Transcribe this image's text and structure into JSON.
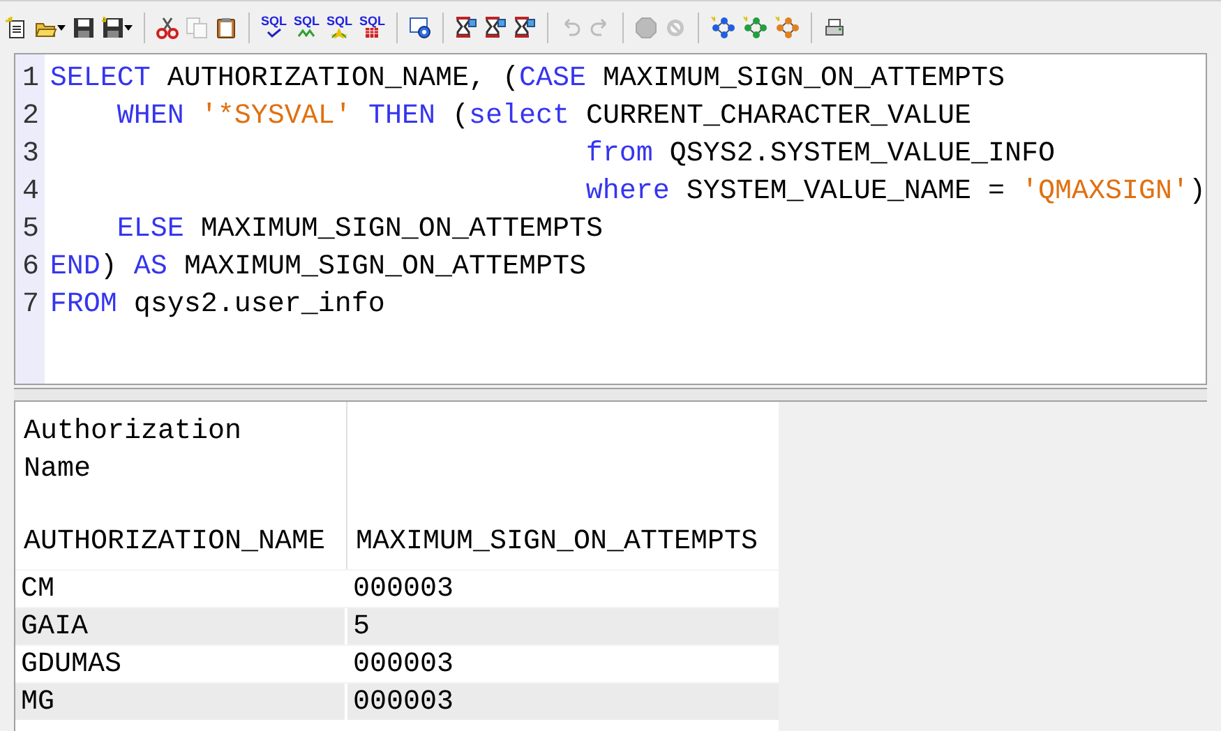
{
  "toolbar": [
    {
      "kind": "new"
    },
    {
      "kind": "open",
      "dropdown": true
    },
    {
      "kind": "save"
    },
    {
      "kind": "save-all",
      "dropdown": true
    },
    {
      "kind": "sep"
    },
    {
      "kind": "cut"
    },
    {
      "kind": "copy",
      "disabled": true
    },
    {
      "kind": "paste"
    },
    {
      "kind": "sep"
    },
    {
      "kind": "sql-check",
      "label": "SQL"
    },
    {
      "kind": "sql-run",
      "label": "SQL"
    },
    {
      "kind": "sql-run-all",
      "label": "SQL"
    },
    {
      "kind": "sql-grid",
      "label": "SQL"
    },
    {
      "kind": "sep"
    },
    {
      "kind": "settings"
    },
    {
      "kind": "sep"
    },
    {
      "kind": "hourglass"
    },
    {
      "kind": "hourglass"
    },
    {
      "kind": "hourglass"
    },
    {
      "kind": "sep"
    },
    {
      "kind": "undo",
      "disabled": true
    },
    {
      "kind": "redo",
      "disabled": true
    },
    {
      "kind": "sep"
    },
    {
      "kind": "stop",
      "disabled": true
    },
    {
      "kind": "cancel",
      "disabled": true
    },
    {
      "kind": "sep"
    },
    {
      "kind": "nodes",
      "color": "#2060e0"
    },
    {
      "kind": "nodes",
      "color": "#20a040"
    },
    {
      "kind": "nodes",
      "color": "#e08020"
    },
    {
      "kind": "sep"
    },
    {
      "kind": "print"
    }
  ],
  "editor": {
    "lines": [
      {
        "number": "1",
        "tokens": [
          {
            "kind": "kw",
            "t": "SELECT"
          },
          {
            "kind": "plain",
            "t": " AUTHORIZATION_NAME, ("
          },
          {
            "kind": "kw",
            "t": "CASE"
          },
          {
            "kind": "plain",
            "t": " MAXIMUM_SIGN_ON_ATTEMPTS"
          }
        ]
      },
      {
        "number": "2",
        "kind": "case-branch",
        "tokens": [
          {
            "kind": "kw",
            "t": "WHEN"
          },
          {
            "kind": "str",
            "t": " '*SYSVAL'"
          },
          {
            "kind": "kw",
            "t": " THEN"
          },
          {
            "kind": "plain",
            "t": " ("
          },
          {
            "kind": "kw",
            "t": "select"
          },
          {
            "kind": "plain",
            "t": " CURRENT_CHARACTER_VALUE"
          }
        ]
      },
      {
        "number": "3",
        "kind": "subquery",
        "tokens": [
          {
            "kind": "kw",
            "t": "from"
          },
          {
            "kind": "plain",
            "t": " QSYS2.SYSTEM_VALUE_INFO"
          }
        ]
      },
      {
        "number": "4",
        "kind": "subquery",
        "tokens": [
          {
            "kind": "kw",
            "t": "where"
          },
          {
            "kind": "plain",
            "t": " SYSTEM_VALUE_NAME = "
          },
          {
            "kind": "str",
            "t": "'QMAXSIGN'"
          },
          {
            "kind": "plain",
            "t": ")"
          }
        ]
      },
      {
        "number": "5",
        "kind": "case-branch",
        "tokens": [
          {
            "kind": "kw",
            "t": "ELSE"
          },
          {
            "kind": "plain",
            "t": " MAXIMUM_SIGN_ON_ATTEMPTS"
          }
        ]
      },
      {
        "number": "6",
        "tokens": [
          {
            "kind": "kw",
            "t": "END"
          },
          {
            "kind": "plain",
            "t": ") "
          },
          {
            "kind": "kw",
            "t": "AS"
          },
          {
            "kind": "plain",
            "t": " MAXIMUM_SIGN_ON_ATTEMPTS"
          }
        ]
      },
      {
        "number": "7",
        "tokens": [
          {
            "kind": "kw",
            "t": "FROM"
          },
          {
            "kind": "plain",
            "t": " qsys2.user_info"
          }
        ]
      }
    ]
  },
  "results": {
    "columns": [
      {
        "heading_lines": [
          "Authorization",
          "Name"
        ],
        "name": "AUTHORIZATION_NAME"
      },
      {
        "name": "MAXIMUM_SIGN_ON_ATTEMPTS"
      }
    ],
    "rows": [
      [
        "CM",
        "000003"
      ],
      [
        "GAIA",
        "5"
      ],
      [
        "GDUMAS",
        "000003"
      ],
      [
        "MG",
        "000003"
      ]
    ]
  }
}
